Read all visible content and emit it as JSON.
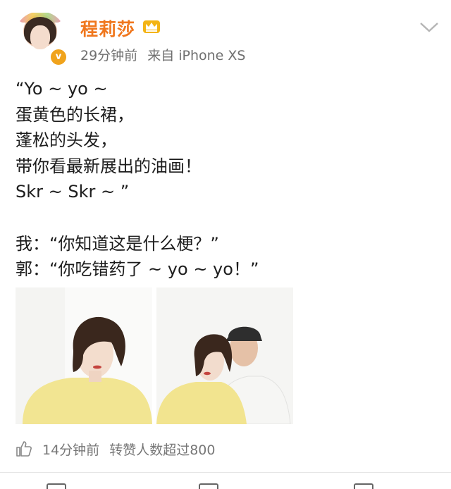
{
  "header": {
    "username": "程莉莎",
    "time": "29分钟前",
    "source": "来自 iPhone XS",
    "verified_icon": "v"
  },
  "content": {
    "lines": [
      "“Yo ~ yo ~",
      "蛋黄色的长裙，",
      "蓬松的头发，",
      "带你看最新展出的油画！",
      "Skr ~ Skr ~ ”",
      "",
      "我：“你知道这是什么梗？”",
      "郭：“你吃错药了 ~ yo ~ yo！”"
    ]
  },
  "footer": {
    "time": "14分钟前",
    "repost_info": "转赞人数超过800"
  },
  "colors": {
    "username": "#f0771d",
    "meta": "#6f6f6f",
    "text": "#1d1d1d"
  },
  "icons": [
    "avatar",
    "crown-icon",
    "chevron-down-icon",
    "like-icon"
  ]
}
